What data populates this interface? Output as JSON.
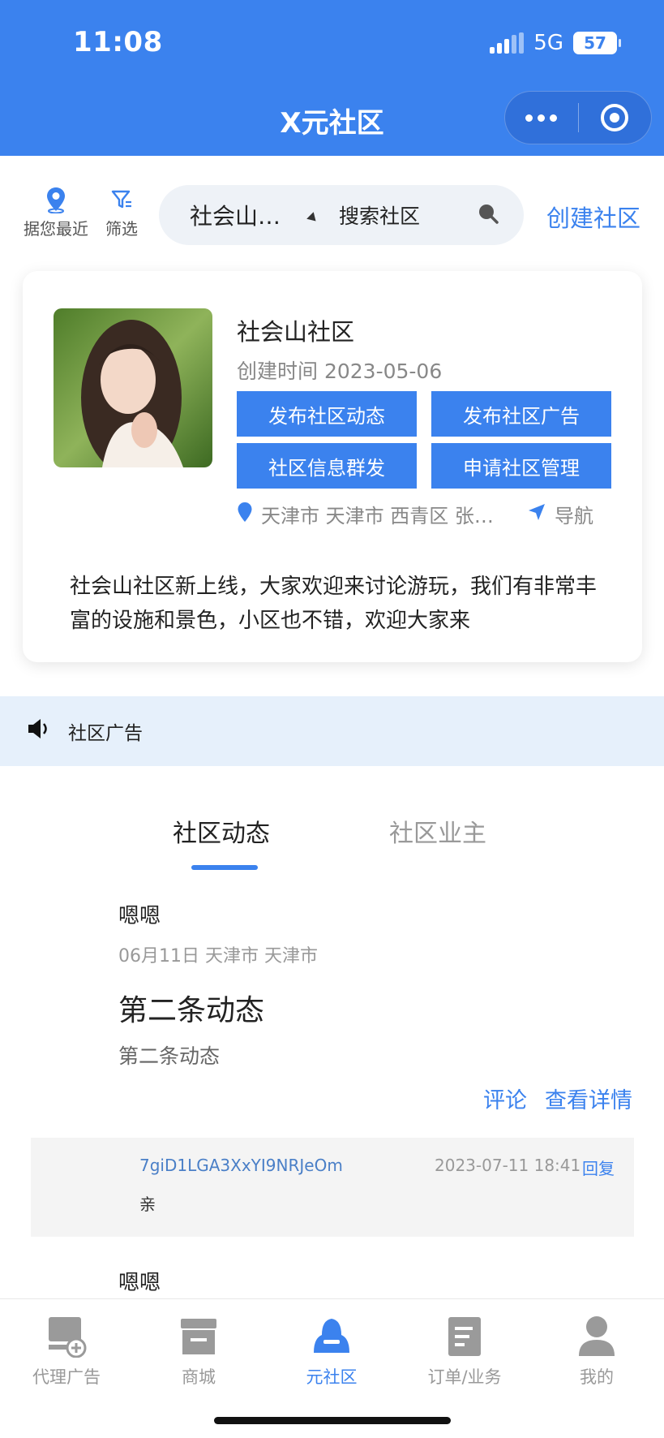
{
  "status": {
    "time": "11:08",
    "network": "5G",
    "battery": "57"
  },
  "nav": {
    "title": "X元社区"
  },
  "tools": {
    "nearest_label": "据您最近",
    "filter_label": "筛选"
  },
  "search": {
    "location": "社会山…",
    "placeholder": "搜索社区",
    "create_label": "创建社区"
  },
  "community": {
    "name": "社会山社区",
    "created": "创建时间 2023-05-06",
    "buttons": [
      "发布社区动态",
      "发布社区广告",
      "社区信息群发",
      "申请社区管理"
    ],
    "address": "天津市 天津市 西青区 张…",
    "nav_label": "导航",
    "description": "社会山社区新上线，大家欢迎来讨论游玩，我们有非常丰富的设施和景色，小区也不错，欢迎大家来"
  },
  "ad": {
    "label": "社区广告"
  },
  "tabs": [
    {
      "label": "社区动态",
      "active": true
    },
    {
      "label": "社区业主",
      "active": false
    }
  ],
  "posts": [
    {
      "author": "嗯嗯",
      "meta": "06月11日 天津市 天津市",
      "title": "第二条动态",
      "body": "第二条动态",
      "comment_label": "评论",
      "detail_label": "查看详情",
      "reply": {
        "user": "7giD1LGA3XxYI9NRJeOm",
        "time": "2023-07-11 18:41",
        "action": "回复",
        "text": "亲"
      }
    },
    {
      "author": "嗯嗯"
    }
  ],
  "bottom_nav": [
    {
      "label": "代理广告",
      "icon": "ad-agent-icon"
    },
    {
      "label": "商城",
      "icon": "shop-icon"
    },
    {
      "label": "元社区",
      "icon": "community-icon",
      "active": true
    },
    {
      "label": "订单/业务",
      "icon": "order-icon"
    },
    {
      "label": "我的",
      "icon": "profile-icon"
    }
  ],
  "colors": {
    "primary": "#3b82ee",
    "ad_bar": "#e6f0fb"
  }
}
